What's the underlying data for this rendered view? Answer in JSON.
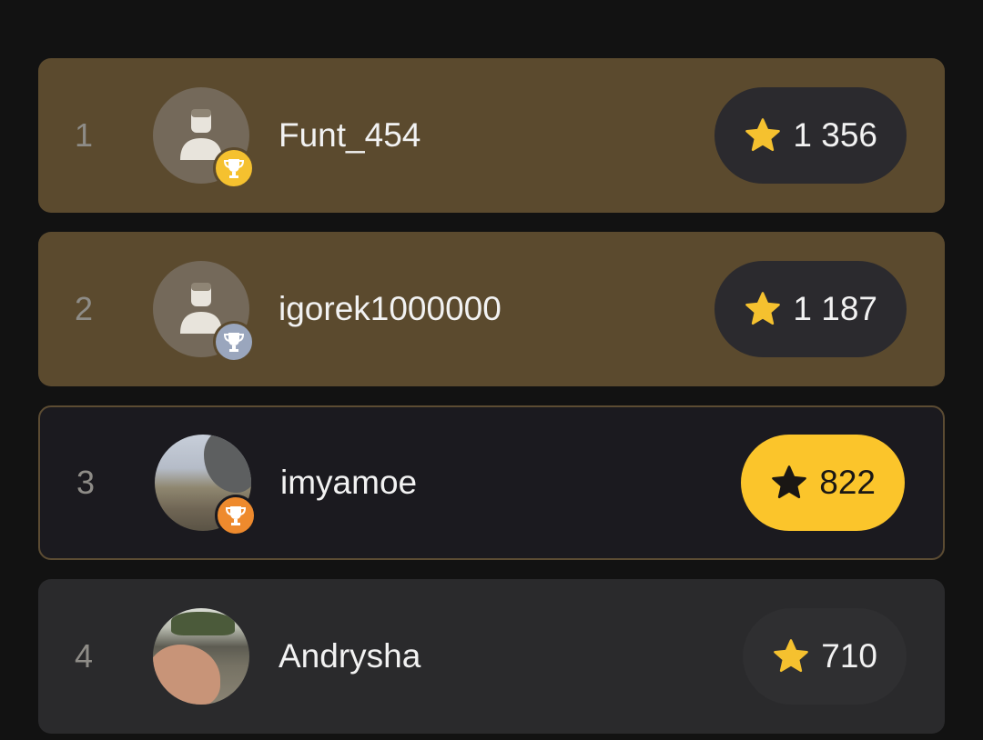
{
  "colors": {
    "background": "#121212",
    "gold_row": "#5b4a2e",
    "highlight_row": "#1b1a1f",
    "plain_row": "#2a2a2c",
    "star": "#f5c12f",
    "yellow_pill": "#fbc52b"
  },
  "leaderboard": [
    {
      "rank": "1",
      "name": "Funt_454",
      "score": "1 356",
      "avatar": "placeholder-user-icon",
      "badge": "gold-trophy-icon"
    },
    {
      "rank": "2",
      "name": "igorek1000000",
      "score": "1 187",
      "avatar": "placeholder-user-icon",
      "badge": "silver-trophy-icon"
    },
    {
      "rank": "3",
      "name": "imyamoe",
      "score": "822",
      "avatar": "photo-avatar",
      "badge": "bronze-trophy-icon",
      "current_user": true
    },
    {
      "rank": "4",
      "name": "Andrysha",
      "score": "710",
      "avatar": "photo-avatar"
    }
  ]
}
